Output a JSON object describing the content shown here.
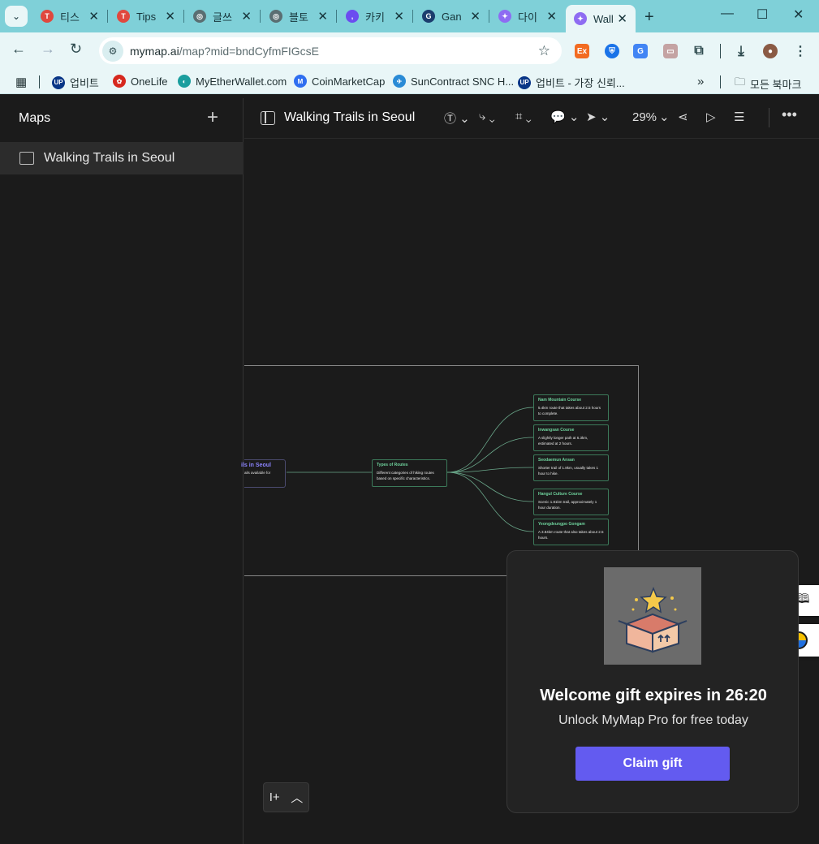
{
  "browser": {
    "tabs": [
      {
        "label": "티스",
        "fav_color": "#e0483e",
        "fav_glyph": "T"
      },
      {
        "label": "Tips",
        "fav_color": "#e0483e",
        "fav_glyph": "T"
      },
      {
        "label": "글쓰",
        "fav_color": "#5a6e72",
        "fav_glyph": "◎"
      },
      {
        "label": "블토",
        "fav_color": "#5a6e72",
        "fav_glyph": "◎"
      },
      {
        "label": "카키",
        "fav_color": "#6b4cf0",
        "fav_glyph": ","
      },
      {
        "label": "Gan",
        "fav_color": "#1b3d6e",
        "fav_glyph": "G"
      },
      {
        "label": "다이",
        "fav_color": "#8e6cf2",
        "fav_glyph": "✦"
      },
      {
        "label": "Wall",
        "fav_color": "#8e6cf2",
        "fav_glyph": "✦"
      }
    ],
    "url_host": "mymap.ai",
    "url_path": "/map?mid=bndCyfmFIGcsE",
    "bookmarks": [
      {
        "label": "업비트",
        "color": "#093687",
        "glyph": "UP"
      },
      {
        "label": "OneLife",
        "color": "#d6281e",
        "glyph": "✿"
      },
      {
        "label": "MyEtherWallet.com",
        "color": "#1a9e9e",
        "glyph": "◐"
      },
      {
        "label": "CoinMarketCap",
        "color": "#2f6ef0",
        "glyph": "M"
      },
      {
        "label": "SunContract SNC H...",
        "color": "#2a8bd6",
        "glyph": "✈"
      },
      {
        "label": "업비트 - 가장 신뢰...",
        "color": "#093687",
        "glyph": "UP"
      }
    ],
    "bookmarks_folder": "모든 북마크"
  },
  "sidebar": {
    "title": "Maps",
    "items": [
      {
        "label": "Walking Trails in Seoul"
      }
    ]
  },
  "header": {
    "title": "Walking Trails in Seoul",
    "zoom": "29%"
  },
  "map": {
    "root": {
      "title": "ils in Seoul",
      "desc": "ails available for"
    },
    "hub": {
      "title": "Types of Routes",
      "desc": "Different categories of hiking routes based on specific characteristics."
    },
    "leaves": [
      {
        "title": "Nam Mountain Course",
        "desc": "5.4km route that takes about 2.5 hours to complete."
      },
      {
        "title": "Inwangsan Course",
        "desc": "A slightly longer path at 6.3km, estimated at 2 hours."
      },
      {
        "title": "Seodaemun Ansan",
        "desc": "Shorter trail of 1.8km, usually takes 1 hour to hike."
      },
      {
        "title": "Hangul Culture Course",
        "desc": "Scenic 1.81km trail, approximately 1 hour duration."
      },
      {
        "title": "Yeongdeungpo Gongam",
        "desc": "A 3.84km route that also takes about 2.5 hours."
      }
    ]
  },
  "popup": {
    "title": "Welcome gift expires in 26:20",
    "subtitle": "Unlock MyMap Pro for free today",
    "button": "Claim gift"
  }
}
